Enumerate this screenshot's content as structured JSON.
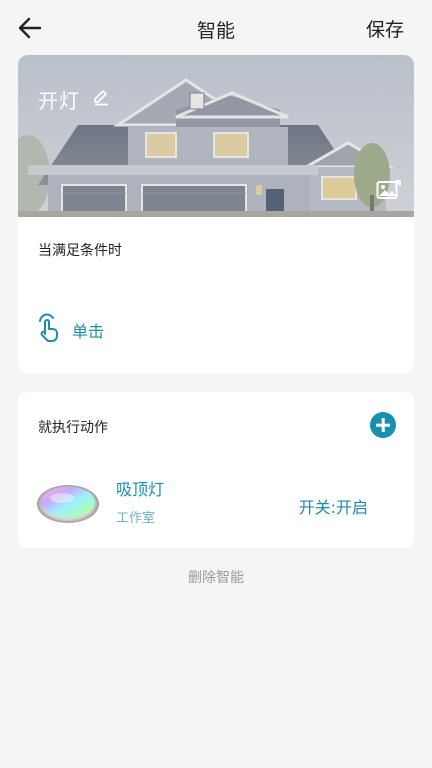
{
  "header": {
    "back_icon": "arrow-left-icon",
    "title": "智能",
    "save_label": "保存"
  },
  "scene": {
    "name": "开灯",
    "edit_icon": "pencil-icon",
    "change_image_icon": "image-icon"
  },
  "condition": {
    "title": "当满足条件时",
    "icon": "tap-hand-icon",
    "label": "单击"
  },
  "action": {
    "title": "就执行动作",
    "add_icon": "plus-icon",
    "device": {
      "icon": "ceiling-light-icon",
      "name": "吸顶灯",
      "room": "工作室",
      "state": "开关:开启"
    }
  },
  "delete_label": "删除智能",
  "colors": {
    "accent": "#1a8ea8",
    "add_button": "#1790b0",
    "background": "#f5f5f5",
    "delete_text": "#9a9a9a"
  }
}
